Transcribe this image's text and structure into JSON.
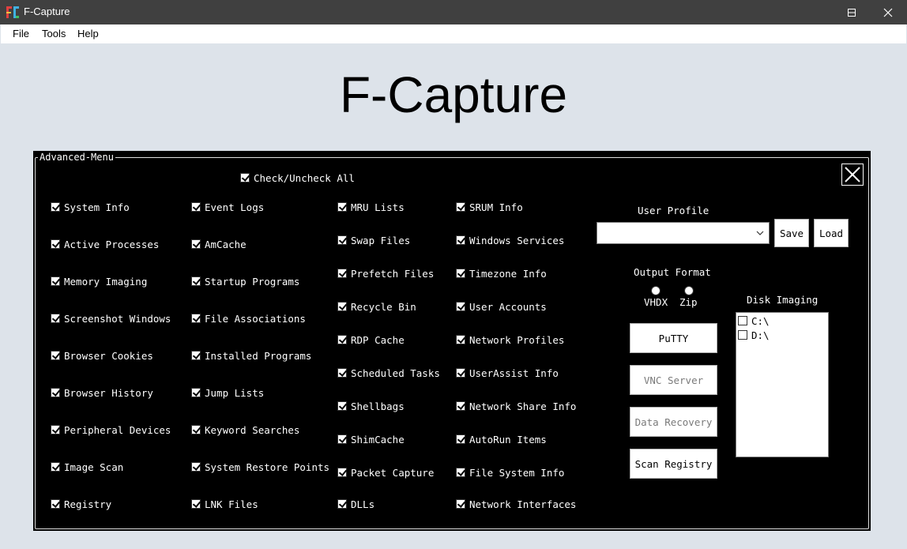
{
  "window": {
    "title": "F-Capture",
    "controls": [
      "minimize",
      "maximize",
      "close"
    ]
  },
  "menu": [
    "File",
    "Tools",
    "Help"
  ],
  "app_title": "F-Capture",
  "panel": {
    "legend": "Advanced-Menu",
    "check_all": {
      "label": "Check/Uncheck All",
      "checked": true
    },
    "columns": [
      [
        {
          "label": "System Info",
          "checked": true
        },
        {
          "label": "Active Processes",
          "checked": true
        },
        {
          "label": "Memory Imaging",
          "checked": true
        },
        {
          "label": "Screenshot Windows",
          "checked": true
        },
        {
          "label": "Browser Cookies",
          "checked": true
        },
        {
          "label": "Browser History",
          "checked": true
        },
        {
          "label": "Peripheral Devices",
          "checked": true
        },
        {
          "label": "Image Scan",
          "checked": true
        },
        {
          "label": "Registry",
          "checked": true
        }
      ],
      [
        {
          "label": "Event Logs",
          "checked": true
        },
        {
          "label": "AmCache",
          "checked": true
        },
        {
          "label": "Startup Programs",
          "checked": true
        },
        {
          "label": "File Associations",
          "checked": true
        },
        {
          "label": "Installed Programs",
          "checked": true
        },
        {
          "label": "Jump Lists",
          "checked": true
        },
        {
          "label": "Keyword Searches",
          "checked": true
        },
        {
          "label": "System Restore Points",
          "checked": true
        },
        {
          "label": "LNK Files",
          "checked": true
        }
      ],
      [
        {
          "label": "MRU Lists",
          "checked": true
        },
        {
          "label": "Swap Files",
          "checked": true
        },
        {
          "label": "Prefetch Files",
          "checked": true
        },
        {
          "label": "Recycle Bin",
          "checked": true
        },
        {
          "label": "RDP Cache",
          "checked": true
        },
        {
          "label": "Scheduled Tasks",
          "checked": true
        },
        {
          "label": "Shellbags",
          "checked": true
        },
        {
          "label": "ShimCache",
          "checked": true
        },
        {
          "label": "Packet Capture",
          "checked": true
        },
        {
          "label": "DLLs",
          "checked": true
        }
      ],
      [
        {
          "label": "SRUM Info",
          "checked": true
        },
        {
          "label": "Windows Services",
          "checked": true
        },
        {
          "label": "Timezone Info",
          "checked": true
        },
        {
          "label": "User Accounts",
          "checked": true
        },
        {
          "label": "Network Profiles",
          "checked": true
        },
        {
          "label": "UserAssist Info",
          "checked": true
        },
        {
          "label": "Network Share Info",
          "checked": true
        },
        {
          "label": "AutoRun Items",
          "checked": true
        },
        {
          "label": "File System Info",
          "checked": true
        },
        {
          "label": "Network Interfaces",
          "checked": true
        }
      ]
    ],
    "user_profile": {
      "label": "User Profile",
      "value": "",
      "save_label": "Save",
      "load_label": "Load"
    },
    "output_format": {
      "label": "Output Format",
      "options": [
        {
          "label": "VHDX",
          "selected": false
        },
        {
          "label": "Zip",
          "selected": false
        }
      ]
    },
    "actions": [
      {
        "label": "PuTTY",
        "enabled": true
      },
      {
        "label": "VNC Server",
        "enabled": false
      },
      {
        "label": "Data Recovery",
        "enabled": false
      },
      {
        "label": "Scan Registry",
        "enabled": true
      }
    ],
    "disk_imaging": {
      "label": "Disk Imaging",
      "drives": [
        {
          "label": "C:\\",
          "checked": false
        },
        {
          "label": "D:\\",
          "checked": false
        }
      ]
    }
  }
}
